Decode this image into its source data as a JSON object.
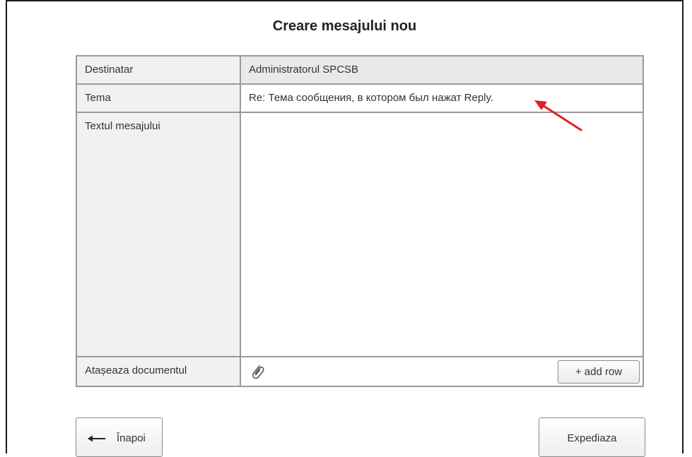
{
  "page": {
    "title": "Creare mesajului nou"
  },
  "form": {
    "recipient": {
      "label": "Destinatar",
      "value": "Administratorul SPCSB"
    },
    "subject": {
      "label": "Tema",
      "value": "Re: Тема сообщения, в котором был нажат Reply."
    },
    "body": {
      "label": "Textul mesajului",
      "value": ""
    },
    "attachment": {
      "label": "Atașeaza documentul",
      "icon": "paperclip-icon",
      "add_row_label": "+ add row"
    }
  },
  "actions": {
    "back_label": "Înapoi",
    "back_icon": "arrow-left-icon",
    "send_label": "Expediaza"
  },
  "annotation": {
    "color": "#e02020",
    "icon": "red-arrow-annotation"
  }
}
